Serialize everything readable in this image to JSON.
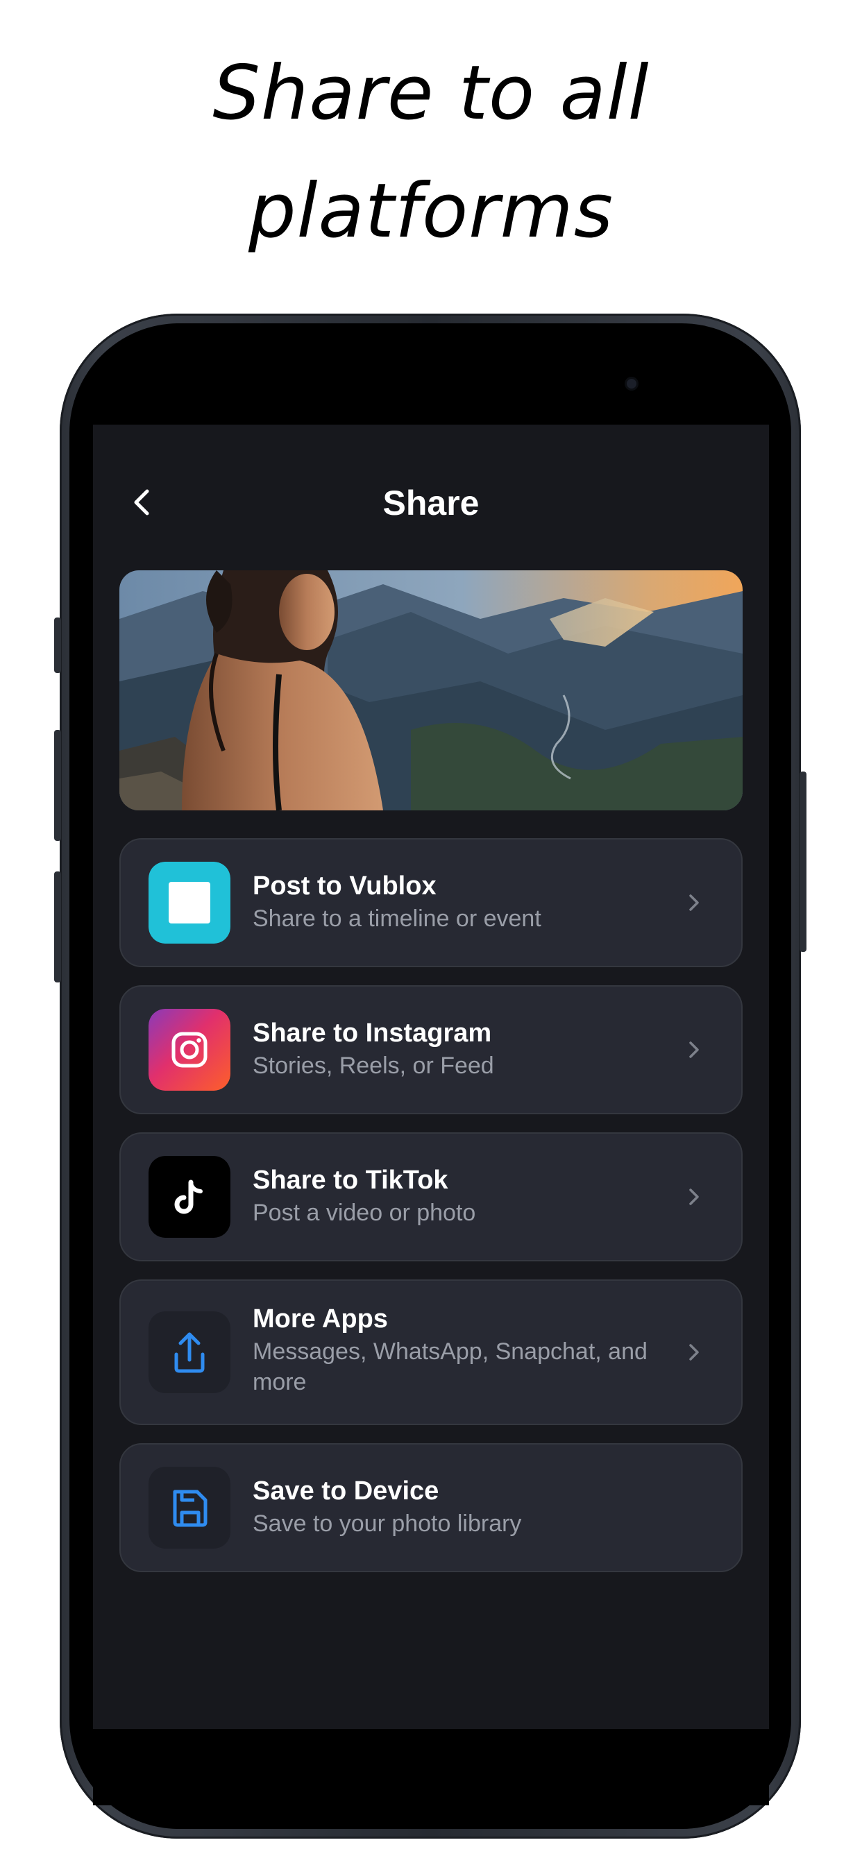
{
  "headline": {
    "line1": "Share to all",
    "line2": "platforms"
  },
  "screen": {
    "title": "Share",
    "back_icon": "chevron-left-icon",
    "preview_image": "woman-overlooking-mountain-valley-photo"
  },
  "share_options": [
    {
      "title": "Post to Vublox",
      "subtitle": "Share to a timeline or event",
      "icon": "vublox-app-icon",
      "icon_color": "#20c1d8"
    },
    {
      "title": "Share to Instagram",
      "subtitle": "Stories, Reels, or Feed",
      "icon": "instagram-icon",
      "icon_color": "#e1306c"
    },
    {
      "title": "Share to TikTok",
      "subtitle": "Post a video or photo",
      "icon": "tiktok-icon",
      "icon_color": "#000000"
    },
    {
      "title": "More Apps",
      "subtitle": "Messages, WhatsApp, Snapchat, and more",
      "icon": "share-upload-icon",
      "icon_color": "#2f8cf0"
    },
    {
      "title": "Save to Device",
      "subtitle": "Save to your photo library",
      "icon": "floppy-disk-save-icon",
      "icon_color": "#2f8cf0"
    }
  ],
  "colors": {
    "screen_background": "#17181d",
    "card_background": "#272933",
    "card_border": "#34373f",
    "accent_blue": "#2f8cf0",
    "subtitle_gray": "#9a9ea8"
  }
}
